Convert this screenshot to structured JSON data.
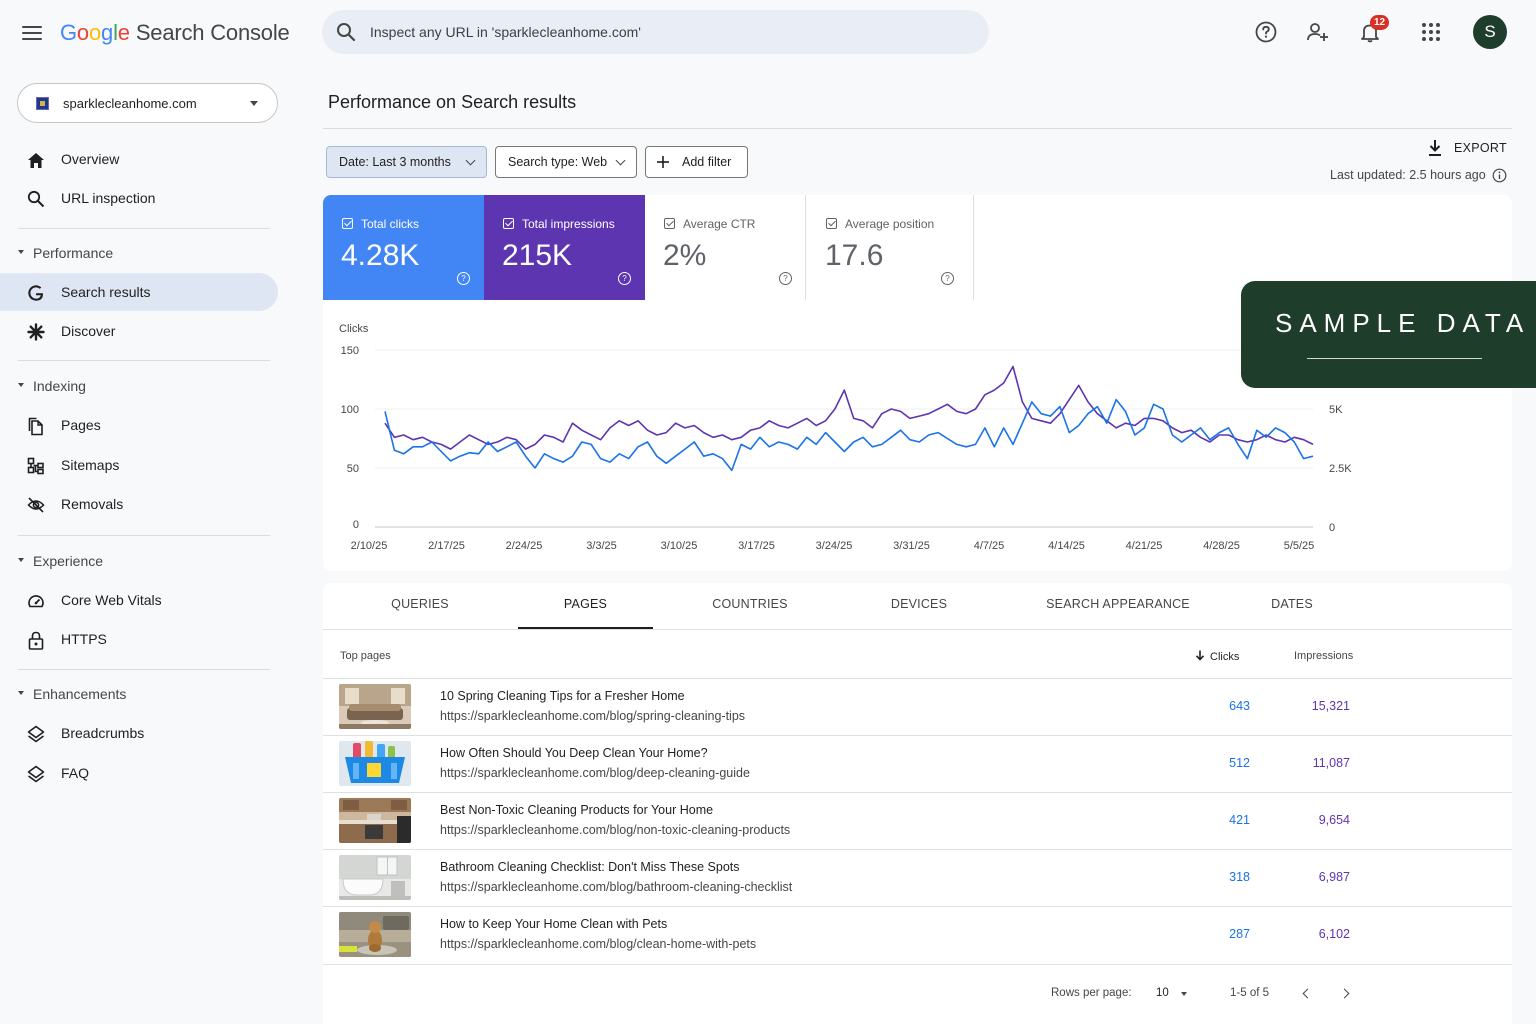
{
  "app": {
    "logo_google": "Google",
    "logo_product": "Search Console",
    "search_placeholder": "Inspect any URL in 'sparklecleanhome.com'",
    "notification_count": "12",
    "avatar_initial": "S"
  },
  "sidebar": {
    "property": "sparklecleanhome.com",
    "top_items": [
      {
        "label": "Overview",
        "icon": "home-icon"
      },
      {
        "label": "URL inspection",
        "icon": "search-icon"
      }
    ],
    "sections": [
      {
        "label": "Performance",
        "items": [
          {
            "label": "Search results",
            "icon": "google-g-icon",
            "active": true
          },
          {
            "label": "Discover",
            "icon": "asterisk-icon"
          }
        ]
      },
      {
        "label": "Indexing",
        "items": [
          {
            "label": "Pages",
            "icon": "pages-icon"
          },
          {
            "label": "Sitemaps",
            "icon": "sitemap-icon"
          },
          {
            "label": "Removals",
            "icon": "eye-off-icon"
          }
        ]
      },
      {
        "label": "Experience",
        "items": [
          {
            "label": "Core Web Vitals",
            "icon": "gauge-icon"
          },
          {
            "label": "HTTPS",
            "icon": "lock-icon"
          }
        ]
      },
      {
        "label": "Enhancements",
        "items": [
          {
            "label": "Breadcrumbs",
            "icon": "layers-icon"
          },
          {
            "label": "FAQ",
            "icon": "layers-icon"
          }
        ]
      }
    ]
  },
  "main": {
    "title": "Performance on Search results",
    "filters": {
      "date": "Date: Last 3 months",
      "search_type": "Search type: Web",
      "add_filter": "Add filter"
    },
    "export_label": "EXPORT",
    "last_updated": "Last updated: 2.5 hours ago",
    "metrics": [
      {
        "label": "Total clicks",
        "value": "4.28K",
        "selected": true,
        "color": "#4285f4"
      },
      {
        "label": "Total impressions",
        "value": "215K",
        "selected": true,
        "color": "#5e35b1"
      },
      {
        "label": "Average CTR",
        "value": "2%",
        "selected": false
      },
      {
        "label": "Average position",
        "value": "17.6",
        "selected": false
      }
    ],
    "watermark": "SAMPLE DATA"
  },
  "chart_data": {
    "type": "line",
    "ylabel": "Clicks",
    "ylim": [
      0,
      150
    ],
    "y2lim": [
      0,
      7500
    ],
    "yticks": [
      "150",
      "100",
      "50",
      "0"
    ],
    "y2ticks": [
      "5K",
      "2.5K",
      "0"
    ],
    "xticks": [
      "2/10/25",
      "2/17/25",
      "2/24/25",
      "3/3/25",
      "3/10/25",
      "3/17/25",
      "3/24/25",
      "3/31/25",
      "4/7/25",
      "4/14/25",
      "4/21/25",
      "4/28/25",
      "5/5/25"
    ],
    "grid": true,
    "series": [
      {
        "axis": "left",
        "color": "#1a73e8",
        "values": [
          98,
          65,
          62,
          68,
          68,
          72,
          64,
          56,
          60,
          63,
          62,
          72,
          64,
          68,
          72,
          60,
          50,
          62,
          58,
          55,
          60,
          72,
          70,
          58,
          55,
          62,
          58,
          68,
          72,
          60,
          54,
          60,
          66,
          72,
          60,
          62,
          58,
          48,
          70,
          66,
          76,
          68,
          72,
          70,
          66,
          76,
          70,
          80,
          72,
          64,
          72,
          76,
          68,
          70,
          76,
          82,
          74,
          72,
          78,
          80,
          75,
          70,
          68,
          70,
          84,
          68,
          84,
          70,
          88,
          106,
          96,
          94,
          102,
          80,
          86,
          96,
          102,
          88,
          108,
          98,
          78,
          84,
          104,
          100,
          78,
          72,
          78,
          84,
          74,
          80,
          84,
          70,
          58,
          82,
          76,
          84,
          80,
          72,
          58,
          60
        ]
      },
      {
        "axis": "right",
        "color": "#5e35b1",
        "values": [
          4400,
          3800,
          3900,
          3700,
          3800,
          3600,
          3500,
          3300,
          3600,
          3900,
          3700,
          3500,
          3600,
          3800,
          3700,
          3300,
          3500,
          3900,
          3800,
          3600,
          4400,
          4100,
          3900,
          3700,
          4200,
          4500,
          4300,
          4500,
          4100,
          3900,
          4000,
          4400,
          4200,
          4300,
          4000,
          3800,
          3900,
          3700,
          3800,
          4100,
          4200,
          4500,
          4300,
          4200,
          4400,
          4600,
          4300,
          4500,
          5000,
          5800,
          4600,
          4500,
          4200,
          4800,
          5000,
          4900,
          4600,
          4700,
          4800,
          5000,
          5200,
          4900,
          4800,
          5000,
          5600,
          5800,
          6100,
          6800,
          5300,
          4600,
          4500,
          4400,
          4800,
          5400,
          6000,
          5300,
          4800,
          4500,
          4200,
          4400,
          4300,
          4600,
          4600,
          4500,
          4200,
          4000,
          4100,
          3800,
          3600,
          3900,
          3900,
          3700,
          3600,
          3700,
          3900,
          3700,
          3600,
          3800,
          3700,
          3500
        ]
      }
    ]
  },
  "table": {
    "tabs": [
      "QUERIES",
      "PAGES",
      "COUNTRIES",
      "DEVICES",
      "SEARCH APPEARANCE",
      "DATES"
    ],
    "active_tab": 1,
    "header_label": "Top pages",
    "col_clicks": "Clicks",
    "col_impressions": "Impressions",
    "rows": [
      {
        "title": "10 Spring Cleaning Tips for a Fresher Home",
        "url": "https://sparklecleanhome.com/blog/spring-cleaning-tips",
        "clicks": "643",
        "impressions": "15,321"
      },
      {
        "title": "How Often Should You Deep Clean Your Home?",
        "url": "https://sparklecleanhome.com/blog/deep-cleaning-guide",
        "clicks": "512",
        "impressions": "11,087"
      },
      {
        "title": "Best Non-Toxic Cleaning Products for Your Home",
        "url": "https://sparklecleanhome.com/blog/non-toxic-cleaning-products",
        "clicks": "421",
        "impressions": "9,654"
      },
      {
        "title": "Bathroom Cleaning Checklist: Don't Miss These Spots",
        "url": "https://sparklecleanhome.com/blog/bathroom-cleaning-checklist",
        "clicks": "318",
        "impressions": "6,987"
      },
      {
        "title": "How to Keep Your Home Clean with Pets",
        "url": "https://sparklecleanhome.com/blog/clean-home-with-pets",
        "clicks": "287",
        "impressions": "6,102"
      }
    ],
    "rows_per_page_label": "Rows per page:",
    "rows_per_page": "10",
    "range": "1-5 of 5"
  }
}
